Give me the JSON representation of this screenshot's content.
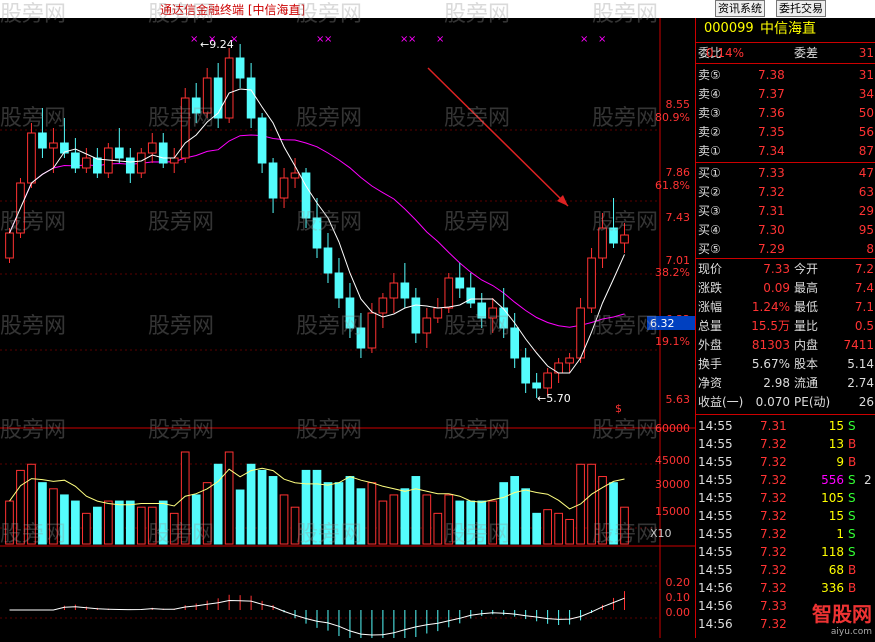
{
  "window": {
    "title": "通达信金融终端 [中信海直]",
    "buttons": [
      "资讯系统",
      "委托交易"
    ]
  },
  "stock": {
    "code": "000099",
    "name": "中信海直"
  },
  "price_axis": {
    "labels": [
      "8.55",
      "80.9%",
      "7.86",
      "61.8%",
      "7.43",
      "7.01",
      "38.2%",
      "6.32",
      "19.1%",
      "5.63"
    ],
    "current_tag": "6.32"
  },
  "volume_axis": {
    "labels": [
      "60000",
      "45000",
      "30000",
      "15000",
      "X10"
    ]
  },
  "macd_axis": {
    "labels": [
      "0.20",
      "0.10",
      "0.00"
    ]
  },
  "annotations": {
    "high": "9.24",
    "low": "5.70",
    "symbol": "$"
  },
  "watermark": "股旁网",
  "brand": {
    "name": "智股网",
    "url": "aiyu.com"
  },
  "order_book": {
    "weibi_label": "委比",
    "weibi_value": "0.14%",
    "weicha_label": "委差",
    "weicha_value": "31",
    "sell": [
      {
        "label": "卖⑤",
        "price": "7.38",
        "vol": "31"
      },
      {
        "label": "卖④",
        "price": "7.37",
        "vol": "34"
      },
      {
        "label": "卖③",
        "price": "7.36",
        "vol": "50"
      },
      {
        "label": "卖②",
        "price": "7.35",
        "vol": "56"
      },
      {
        "label": "卖①",
        "price": "7.34",
        "vol": "87"
      }
    ],
    "buy": [
      {
        "label": "买①",
        "price": "7.33",
        "vol": "47"
      },
      {
        "label": "买②",
        "price": "7.32",
        "vol": "63"
      },
      {
        "label": "买③",
        "price": "7.31",
        "vol": "29"
      },
      {
        "label": "买④",
        "price": "7.30",
        "vol": "95"
      },
      {
        "label": "买⑤",
        "price": "7.29",
        "vol": "8"
      }
    ]
  },
  "quote": [
    {
      "l1": "现价",
      "v1": "7.33",
      "l2": "今开",
      "v2": "7.2"
    },
    {
      "l1": "涨跌",
      "v1": "0.09",
      "l2": "最高",
      "v2": "7.4"
    },
    {
      "l1": "涨幅",
      "v1": "1.24%",
      "l2": "最低",
      "v2": "7.1"
    },
    {
      "l1": "总量",
      "v1": "15.5万",
      "l2": "量比",
      "v2": "0.5"
    },
    {
      "l1": "外盘",
      "v1": "81303",
      "l2": "内盘",
      "v2": "7411"
    },
    {
      "l1": "换手",
      "v1": "5.67%",
      "l2": "股本",
      "v2": "5.14"
    },
    {
      "l1": "净资",
      "v1": "2.98",
      "l2": "流通",
      "v2": "2.74"
    },
    {
      "l1": "收益(一)",
      "v1": "0.070",
      "l2": "PE(动)",
      "v2": "26"
    }
  ],
  "ticks": [
    {
      "time": "14:55",
      "price": "7.31",
      "vol": "15",
      "side": "S"
    },
    {
      "time": "14:55",
      "price": "7.32",
      "vol": "13",
      "side": "B"
    },
    {
      "time": "14:55",
      "price": "7.32",
      "vol": "9",
      "side": "B"
    },
    {
      "time": "14:55",
      "price": "7.32",
      "vol": "556",
      "side": "S",
      "extra": "2"
    },
    {
      "time": "14:55",
      "price": "7.32",
      "vol": "105",
      "side": "S"
    },
    {
      "time": "14:55",
      "price": "7.32",
      "vol": "15",
      "side": "S"
    },
    {
      "time": "14:55",
      "price": "7.32",
      "vol": "1",
      "side": "S"
    },
    {
      "time": "14:55",
      "price": "7.32",
      "vol": "118",
      "side": "S"
    },
    {
      "time": "14:55",
      "price": "7.32",
      "vol": "68",
      "side": "B"
    },
    {
      "time": "14:56",
      "price": "7.32",
      "vol": "336",
      "side": "B"
    },
    {
      "time": "14:56",
      "price": "7.33",
      "vol": "",
      "side": ""
    },
    {
      "time": "14:56",
      "price": "7.32",
      "vol": "",
      "side": ""
    }
  ],
  "colors": {
    "up": "#ff3232",
    "down": "#54fcfc",
    "ma_short": "#ffffff",
    "ma_long": "#ff00ff",
    "volume_ma": "#ffff80"
  },
  "chart_data": {
    "type": "candlestick",
    "y_range": [
      5.5,
      9.4
    ],
    "candles": [
      [
        7.1,
        7.4,
        7.05,
        7.35
      ],
      [
        7.35,
        7.9,
        7.3,
        7.85
      ],
      [
        7.85,
        8.45,
        7.8,
        8.35
      ],
      [
        8.35,
        8.6,
        8.1,
        8.2
      ],
      [
        8.2,
        8.4,
        7.95,
        8.25
      ],
      [
        8.25,
        8.5,
        8.1,
        8.15
      ],
      [
        8.15,
        8.3,
        7.95,
        8.0
      ],
      [
        8.0,
        8.2,
        7.95,
        8.1
      ],
      [
        8.1,
        8.2,
        7.9,
        7.95
      ],
      [
        7.95,
        8.25,
        7.9,
        8.2
      ],
      [
        8.2,
        8.4,
        8.05,
        8.1
      ],
      [
        8.1,
        8.2,
        7.85,
        7.95
      ],
      [
        7.95,
        8.2,
        7.9,
        8.15
      ],
      [
        8.15,
        8.35,
        8.05,
        8.25
      ],
      [
        8.25,
        8.35,
        8.0,
        8.05
      ],
      [
        8.05,
        8.2,
        7.95,
        8.1
      ],
      [
        8.1,
        8.8,
        8.05,
        8.7
      ],
      [
        8.7,
        8.85,
        8.45,
        8.55
      ],
      [
        8.55,
        9.0,
        8.5,
        8.9
      ],
      [
        8.9,
        9.05,
        8.4,
        8.5
      ],
      [
        8.5,
        9.2,
        8.45,
        9.1
      ],
      [
        9.1,
        9.24,
        8.8,
        8.9
      ],
      [
        8.9,
        9.05,
        8.4,
        8.5
      ],
      [
        8.5,
        8.55,
        7.95,
        8.05
      ],
      [
        8.05,
        8.1,
        7.55,
        7.7
      ],
      [
        7.7,
        8.0,
        7.6,
        7.9
      ],
      [
        7.9,
        8.1,
        7.8,
        7.95
      ],
      [
        7.95,
        8.0,
        7.4,
        7.5
      ],
      [
        7.5,
        7.7,
        7.1,
        7.2
      ],
      [
        7.2,
        7.35,
        6.85,
        6.95
      ],
      [
        6.95,
        7.1,
        6.6,
        6.7
      ],
      [
        6.7,
        6.85,
        6.3,
        6.4
      ],
      [
        6.4,
        6.55,
        6.1,
        6.2
      ],
      [
        6.2,
        6.65,
        6.15,
        6.55
      ],
      [
        6.55,
        6.75,
        6.4,
        6.7
      ],
      [
        6.7,
        6.95,
        6.55,
        6.85
      ],
      [
        6.85,
        7.05,
        6.6,
        6.7
      ],
      [
        6.7,
        6.8,
        6.25,
        6.35
      ],
      [
        6.35,
        6.6,
        6.2,
        6.5
      ],
      [
        6.5,
        6.7,
        6.45,
        6.6
      ],
      [
        6.6,
        6.95,
        6.55,
        6.9
      ],
      [
        6.9,
        7.05,
        6.7,
        6.8
      ],
      [
        6.8,
        6.95,
        6.6,
        6.65
      ],
      [
        6.65,
        6.75,
        6.4,
        6.5
      ],
      [
        6.5,
        6.7,
        6.35,
        6.6
      ],
      [
        6.6,
        6.8,
        6.3,
        6.4
      ],
      [
        6.4,
        6.55,
        6.0,
        6.1
      ],
      [
        6.1,
        6.2,
        5.75,
        5.85
      ],
      [
        5.85,
        5.95,
        5.7,
        5.8
      ],
      [
        5.8,
        6.0,
        5.72,
        5.95
      ],
      [
        5.95,
        6.1,
        5.85,
        6.05
      ],
      [
        6.05,
        6.15,
        5.95,
        6.1
      ],
      [
        6.1,
        6.7,
        6.05,
        6.6
      ],
      [
        6.6,
        7.2,
        6.55,
        7.1
      ],
      [
        7.1,
        7.55,
        7.0,
        7.4
      ],
      [
        7.4,
        7.7,
        7.2,
        7.25
      ],
      [
        7.25,
        7.45,
        7.15,
        7.33
      ]
    ]
  }
}
